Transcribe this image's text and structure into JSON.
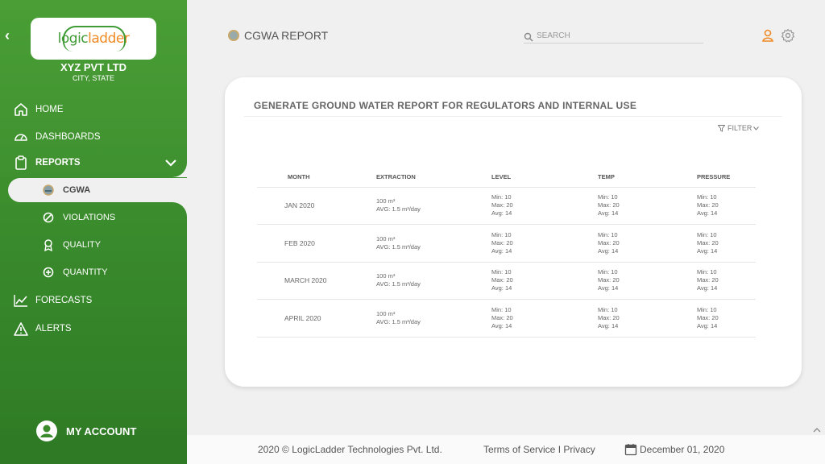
{
  "sidebar": {
    "org_name": "XYZ PVT LTD",
    "org_location": "CITY, STATE",
    "logo": {
      "part1": "logic",
      "part2": "ladder"
    },
    "items": [
      {
        "label": "HOME",
        "icon": "home-icon"
      },
      {
        "label": "DASHBOARDS",
        "icon": "dashboard-gauge-icon"
      },
      {
        "label": "REPORTS",
        "icon": "clipboard-icon"
      },
      {
        "label": "FORECASTS",
        "icon": "trend-line-icon"
      },
      {
        "label": "ALERTS",
        "icon": "warning-icon"
      }
    ],
    "sub_items": [
      {
        "label": "CGWA",
        "icon": "cgwa-emblem-icon",
        "active": true
      },
      {
        "label": "VIOLATIONS",
        "icon": "ban-icon"
      },
      {
        "label": "QUALITY",
        "icon": "award-icon"
      },
      {
        "label": "QUANTITY",
        "icon": "plus-circle-icon"
      }
    ],
    "account_label": "MY ACCOUNT"
  },
  "header": {
    "title": "CGWA REPORT",
    "search_placeholder": "SEARCH"
  },
  "card": {
    "title": "GENERATE GROUND WATER REPORT FOR REGULATORS AND INTERNAL USE",
    "filter_label": "FILTER"
  },
  "table": {
    "columns": [
      "MONTH",
      "EXTRACTION",
      "LEVEL",
      "TEMP",
      "PRESSURE"
    ],
    "rows": [
      {
        "month": "JAN 2020",
        "extraction": "100 m³",
        "extraction_avg": "AVG: 1.5 m³/day",
        "level": [
          "Min: 10",
          "Max: 20",
          "Avg: 14"
        ],
        "temp": [
          "Min: 10",
          "Max: 20",
          "Avg: 14"
        ],
        "pressure": [
          "Min: 10",
          "Max: 20",
          "Avg: 14"
        ]
      },
      {
        "month": "FEB 2020",
        "extraction": "100 m³",
        "extraction_avg": "AVG: 1.5 m³/day",
        "level": [
          "Min: 10",
          "Max: 20",
          "Avg: 14"
        ],
        "temp": [
          "Min: 10",
          "Max: 20",
          "Avg: 14"
        ],
        "pressure": [
          "Min: 10",
          "Max: 20",
          "Avg: 14"
        ]
      },
      {
        "month": "MARCH 2020",
        "extraction": "100 m³",
        "extraction_avg": "AVG: 1.5 m³/day",
        "level": [
          "Min: 10",
          "Max: 20",
          "Avg: 14"
        ],
        "temp": [
          "Min: 10",
          "Max: 20",
          "Avg: 14"
        ],
        "pressure": [
          "Min: 10",
          "Max: 20",
          "Avg: 14"
        ]
      },
      {
        "month": "APRIL 2020",
        "extraction": "100 m³",
        "extraction_avg": "AVG: 1.5 m³/day",
        "level": [
          "Min: 10",
          "Max: 20",
          "Avg: 14"
        ],
        "temp": [
          "Min: 10",
          "Max: 20",
          "Avg: 14"
        ],
        "pressure": [
          "Min: 10",
          "Max: 20",
          "Avg: 14"
        ]
      }
    ]
  },
  "footer": {
    "copyright": "2020 © LogicLadder Technologies Pvt. Ltd.",
    "links": "Terms of Service I Privacy",
    "date": "December 01, 2020"
  },
  "colors": {
    "sidebar_green": "#3f9130",
    "accent_orange": "#f08a24",
    "logo_green": "#3f9b35"
  }
}
